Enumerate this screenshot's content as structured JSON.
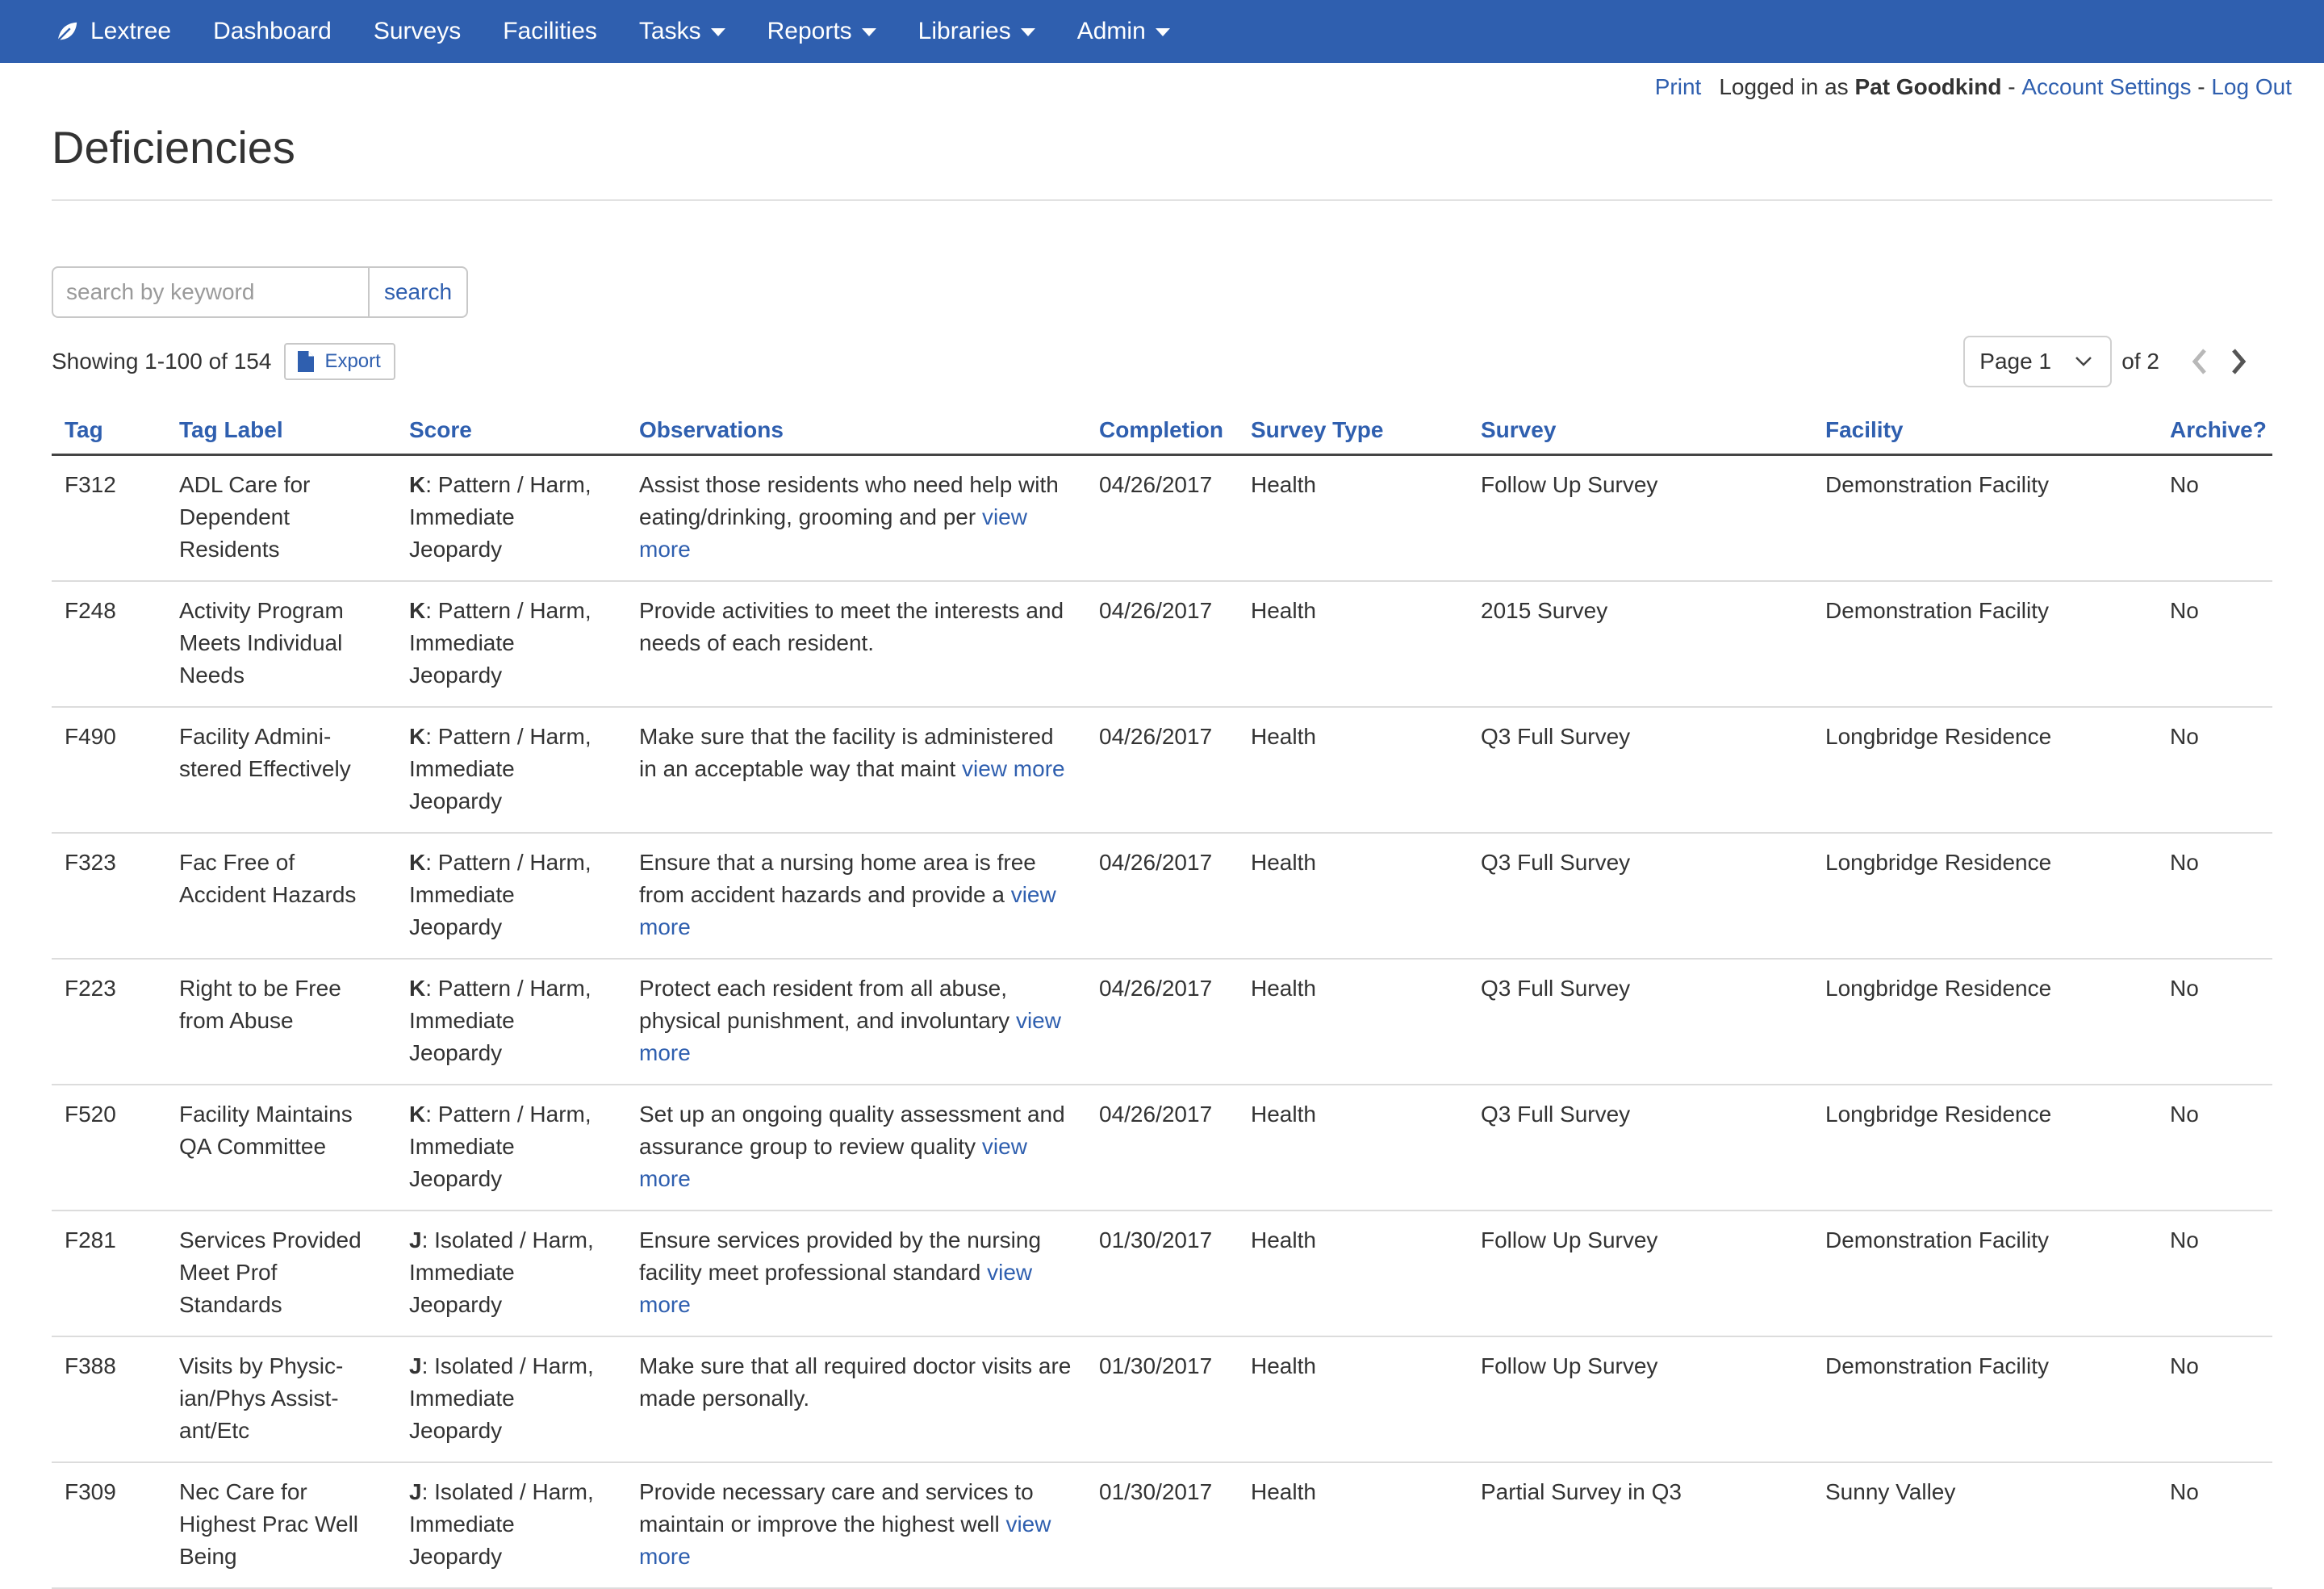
{
  "nav": {
    "brand": "Lextree",
    "items": [
      {
        "label": "Dashboard",
        "dropdown": false
      },
      {
        "label": "Surveys",
        "dropdown": false
      },
      {
        "label": "Facilities",
        "dropdown": false
      },
      {
        "label": "Tasks",
        "dropdown": true
      },
      {
        "label": "Reports",
        "dropdown": true
      },
      {
        "label": "Libraries",
        "dropdown": true
      },
      {
        "label": "Admin",
        "dropdown": true
      }
    ],
    "color": "#2f5faf"
  },
  "userbar": {
    "print": "Print",
    "logged_in_as": "Logged in as",
    "user": "Pat Goodkind",
    "sep": "-",
    "account_settings": "Account Settings",
    "log_out": "Log Out"
  },
  "page": {
    "title": "Deficiencies"
  },
  "search": {
    "placeholder": "search by keyword",
    "value": "",
    "button": "search"
  },
  "results": {
    "showing": "Showing 1-100 of 154",
    "export": "Export"
  },
  "pagination": {
    "current": "Page 1",
    "of": "of 2"
  },
  "table": {
    "columns": [
      "Tag",
      "Tag Label",
      "Score",
      "Observations",
      "Completion",
      "Survey Type",
      "Survey",
      "Facility",
      "Archive?"
    ],
    "view_more": "view more",
    "rows": [
      {
        "tag": "F312",
        "label": "ADL Care for Dependent Residents",
        "score_code": "K",
        "score_text": ": Pattern / Harm, Immediate Jeopardy",
        "obs": "Assist those residents who need help with eating/drinking, grooming and per",
        "more": true,
        "completion": "04/26/2017",
        "type": "Health",
        "survey": "Follow Up Survey",
        "facility": "Demonstration Facility",
        "archive": "No"
      },
      {
        "tag": "F248",
        "label": "Activity Program Meets Individual Needs",
        "score_code": "K",
        "score_text": ": Pattern / Harm, Immediate Jeopardy",
        "obs": "Provide activities to meet the interests and needs of each resident.",
        "more": false,
        "completion": "04/26/2017",
        "type": "Health",
        "survey": "2015 Survey",
        "facility": "Demonstration Facility",
        "archive": "No"
      },
      {
        "tag": "F490",
        "label": "Facility Admini-stered Effectively",
        "score_code": "K",
        "score_text": ": Pattern / Harm, Immediate Jeopardy",
        "obs": "Make sure that the facility is administered in an acceptable way that maint",
        "more": true,
        "completion": "04/26/2017",
        "type": "Health",
        "survey": "Q3 Full Survey",
        "facility": "Longbridge Residence",
        "archive": "No"
      },
      {
        "tag": "F323",
        "label": "Fac Free of Accident Hazards",
        "score_code": "K",
        "score_text": ": Pattern / Harm, Immediate Jeopardy",
        "obs": "Ensure that a nursing home area is free from accident hazards and provide a",
        "more": true,
        "completion": "04/26/2017",
        "type": "Health",
        "survey": "Q3 Full Survey",
        "facility": "Longbridge Residence",
        "archive": "No"
      },
      {
        "tag": "F223",
        "label": "Right to be Free from Abuse",
        "score_code": "K",
        "score_text": ": Pattern / Harm, Immediate Jeopardy",
        "obs": "Protect each resident from all abuse, physical punishment, and involuntary",
        "more": true,
        "completion": "04/26/2017",
        "type": "Health",
        "survey": "Q3 Full Survey",
        "facility": "Longbridge Residence",
        "archive": "No"
      },
      {
        "tag": "F520",
        "label": "Facility Maintains QA Committee",
        "score_code": "K",
        "score_text": ": Pattern / Harm, Immediate Jeopardy",
        "obs": "Set up an ongoing quality assessment and assurance group to review quality",
        "more": true,
        "completion": "04/26/2017",
        "type": "Health",
        "survey": "Q3 Full Survey",
        "facility": "Longbridge Residence",
        "archive": "No"
      },
      {
        "tag": "F281",
        "label": "Services Provided Meet Prof Standards",
        "score_code": "J",
        "score_text": ": Isolated / Harm, Immediate Jeopardy",
        "obs": "Ensure services provided by the nursing facility meet professional standard",
        "more": true,
        "completion": "01/30/2017",
        "type": "Health",
        "survey": "Follow Up Survey",
        "facility": "Demonstration Facility",
        "archive": "No"
      },
      {
        "tag": "F388",
        "label": "Visits by Physic-ian/Phys Assist-ant/Etc",
        "score_code": "J",
        "score_text": ": Isolated / Harm, Immediate Jeopardy",
        "obs": "Make sure that all required doctor visits are made personally.",
        "more": false,
        "completion": "01/30/2017",
        "type": "Health",
        "survey": "Follow Up Survey",
        "facility": "Demonstration Facility",
        "archive": "No"
      },
      {
        "tag": "F309",
        "label": "Nec Care for Highest Prac Well Being",
        "score_code": "J",
        "score_text": ": Isolated / Harm, Immediate Jeopardy",
        "obs": "Provide necessary care and services to maintain or improve the highest well",
        "more": true,
        "completion": "01/30/2017",
        "type": "Health",
        "survey": "Partial Survey in Q3",
        "facility": "Sunny Valley",
        "archive": "No"
      }
    ]
  }
}
